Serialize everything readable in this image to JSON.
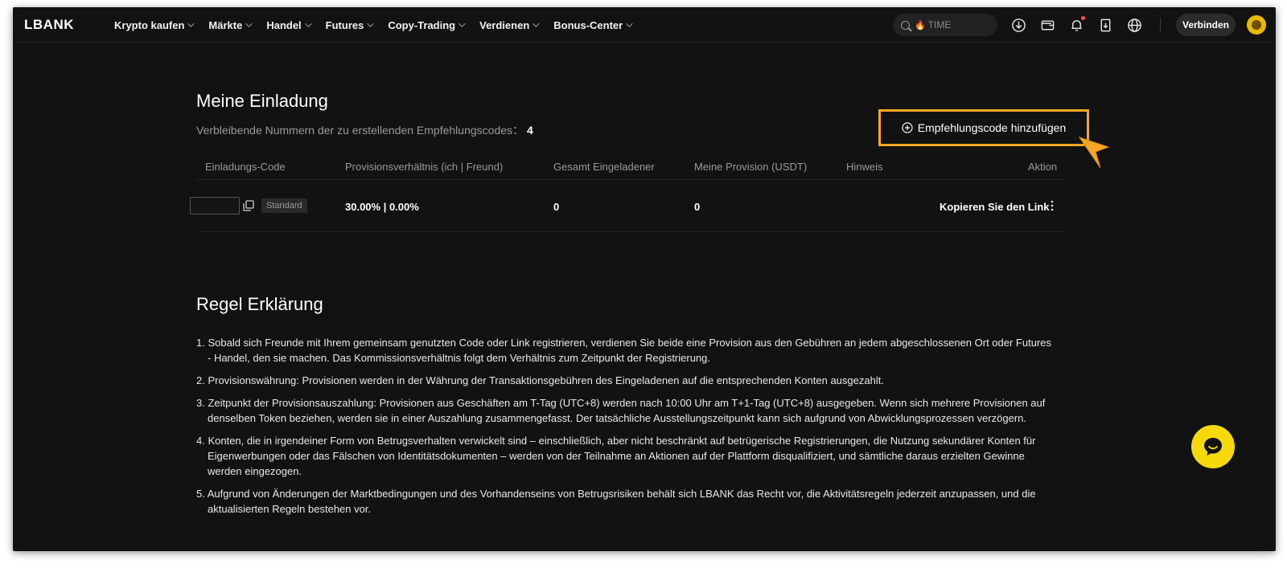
{
  "brand": "LBANK",
  "nav": {
    "items": [
      {
        "label": "Krypto kaufen"
      },
      {
        "label": "Märkte"
      },
      {
        "label": "Handel"
      },
      {
        "label": "Futures"
      },
      {
        "label": "Copy-Trading"
      },
      {
        "label": "Verdienen"
      },
      {
        "label": "Bonus-Center"
      }
    ],
    "search_placeholder": "TIME",
    "search_hot_icon": "fire-icon",
    "icons": [
      "download-icon",
      "wallet-icon",
      "bell-icon",
      "order-icon",
      "globe-icon"
    ],
    "connect_label": "Verbinden"
  },
  "invitation": {
    "title": "Meine Einladung",
    "remaining_label": "Verbleibende Nummern der zu erstellenden Empfehlungscodes：",
    "remaining_count": "4",
    "add_button_label": "Empfehlungscode hinzufügen",
    "columns": [
      "Einladungs-Code",
      "Provisionsverhältnis (ich | Freund)",
      "Gesamt Eingeladener",
      "Meine Provision (USDT)",
      "Hinweis",
      "Aktion"
    ],
    "rows": [
      {
        "code": "",
        "badge": "Standard",
        "ratio": "30.00% | 0.00%",
        "total_invited": "0",
        "commission": "0",
        "note": "",
        "action": "Kopieren Sie den Link"
      }
    ]
  },
  "rules": {
    "title": "Regel Erklärung",
    "items": [
      "1. Sobald sich Freunde mit Ihrem gemeinsam genutzten Code oder Link registrieren, verdienen Sie beide eine Provision aus den Gebühren an jedem abgeschlossenen Ort oder Futures - Handel, den sie machen. Das Kommissionsverhältnis folgt dem Verhältnis zum Zeitpunkt der Registrierung.",
      "2. Provisionswährung: Provisionen werden in der Währung der Transaktionsgebühren des Eingeladenen auf die entsprechenden Konten ausgezahlt.",
      "3. Zeitpunkt der Provisionsauszahlung: Provisionen aus Geschäften am T-Tag (UTC+8) werden nach 10:00 Uhr am T+1-Tag (UTC+8) ausgegeben. Wenn sich mehrere Provisionen auf denselben Token beziehen, werden sie in einer Auszahlung zusammengefasst. Der tatsächliche Ausstellungszeitpunkt kann sich aufgrund von Abwicklungsprozessen verzögern.",
      "4. Konten, die in irgendeiner Form von Betrugsverhalten verwickelt sind – einschließlich, aber nicht beschränkt auf betrügerische Registrierungen, die Nutzung sekundärer Konten für Eigenwerbungen oder das Fälschen von Identitätsdokumenten – werden von der Teilnahme an Aktionen auf der Plattform disqualifiziert, und sämtliche daraus erzielten Gewinne werden eingezogen.",
      "5. Aufgrund von Änderungen der Marktbedingungen und des Vorhandenseins von Betrugsrisiken behält sich LBANK das Recht vor, die Aktivitätsregeln jederzeit anzupassen, und die aktualisierten Regeln bestehen vor."
    ]
  },
  "colors": {
    "background": "#121212",
    "highlight": "#f5a623",
    "chat": "#f5d90a"
  }
}
